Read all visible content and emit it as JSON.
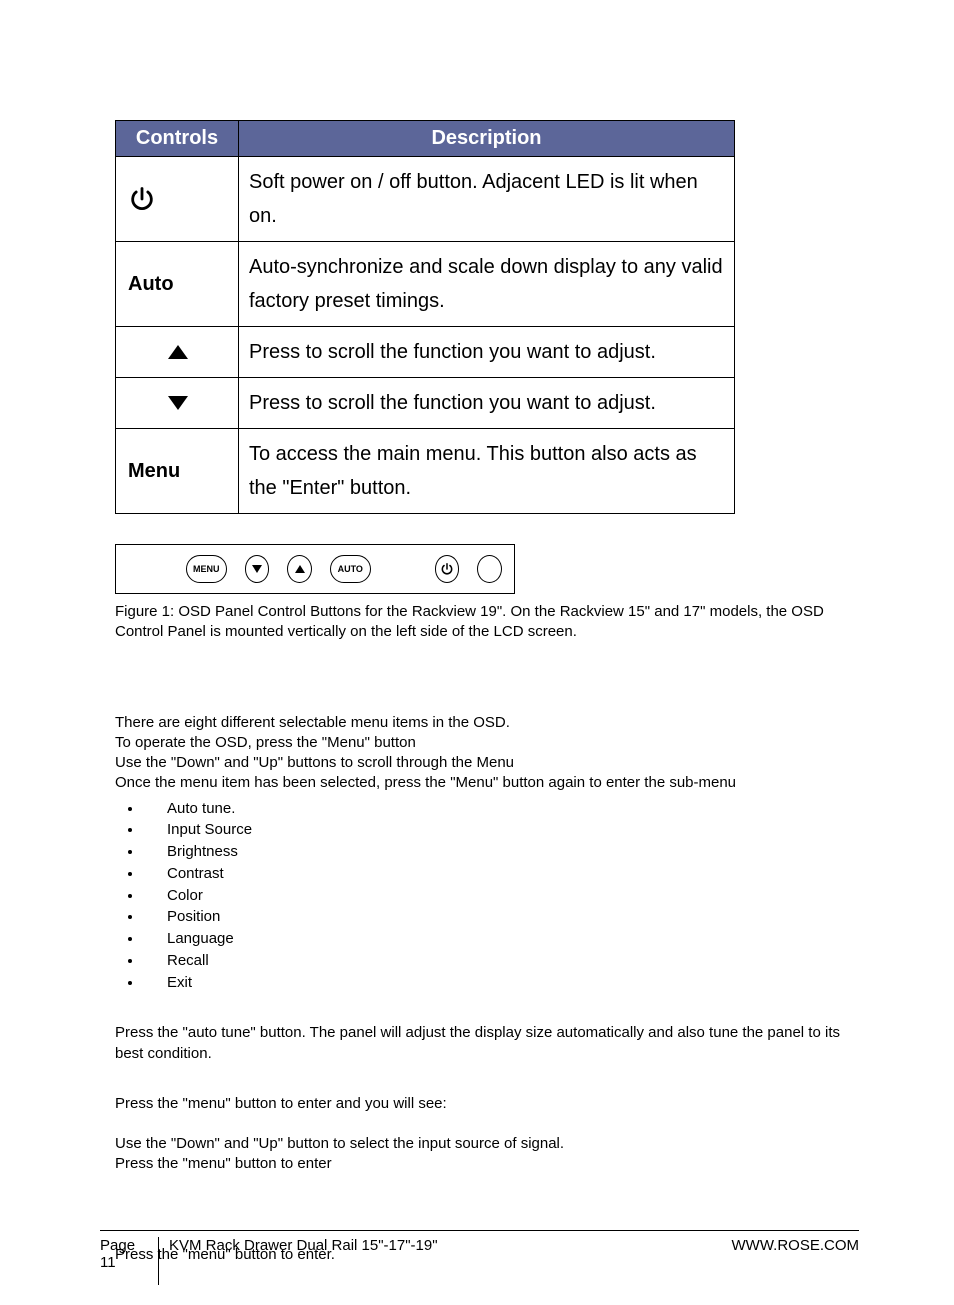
{
  "table": {
    "headers": {
      "controls": "Controls",
      "description": "Description"
    },
    "rows": [
      {
        "control_type": "power-icon",
        "description": "Soft power on / off button. Adjacent LED is lit when on."
      },
      {
        "control_type": "text",
        "control_label": "Auto",
        "description": "Auto-synchronize and scale down display to any valid factory preset timings."
      },
      {
        "control_type": "up-icon",
        "description": "Press to scroll the function you want to adjust."
      },
      {
        "control_type": "down-icon",
        "description": "Press to scroll the function you want to adjust."
      },
      {
        "control_type": "text",
        "control_label": "Menu",
        "description": "To access the main menu. This button also acts as the \"Enter\" button."
      }
    ]
  },
  "panel": {
    "buttons": [
      "MENU",
      "down",
      "up",
      "AUTO",
      "power",
      "led"
    ]
  },
  "caption": "Figure 1:  OSD Panel Control Buttons for the Rackview 19\".  On the Rackview 15\" and 17\" models, the OSD Control Panel is mounted vertically on the left side of the LCD screen.",
  "body": {
    "intro": [
      "There are eight different selectable menu items in the OSD.",
      "To operate the OSD, press the \"Menu\" button",
      "Use the \"Down\" and \"Up\" buttons to scroll through the Menu",
      "Once the menu item has been selected, press the \"Menu\" button again to enter the sub-menu"
    ],
    "menu_items": [
      "Auto tune.",
      "Input Source",
      "Brightness",
      "Contrast",
      "Color",
      "Position",
      "Language",
      "Recall",
      "Exit"
    ],
    "para1": "Press the \"auto tune\" button. The panel will adjust the display size automatically and also tune the panel to its best condition.",
    "para2": "Press the \"menu\" button to enter and you will see:",
    "para3a": "Use the \"Down\" and \"Up\" button to select the input source of signal.",
    "para3b": "Press the \"menu\" button to enter",
    "para4": "Press the \"menu\" button to enter."
  },
  "footer": {
    "page_label": "Page",
    "page_number": "11",
    "title": "KVM Rack Drawer  Dual Rail  15\"-17\"-19\"",
    "url": "WWW.ROSE.COM"
  }
}
